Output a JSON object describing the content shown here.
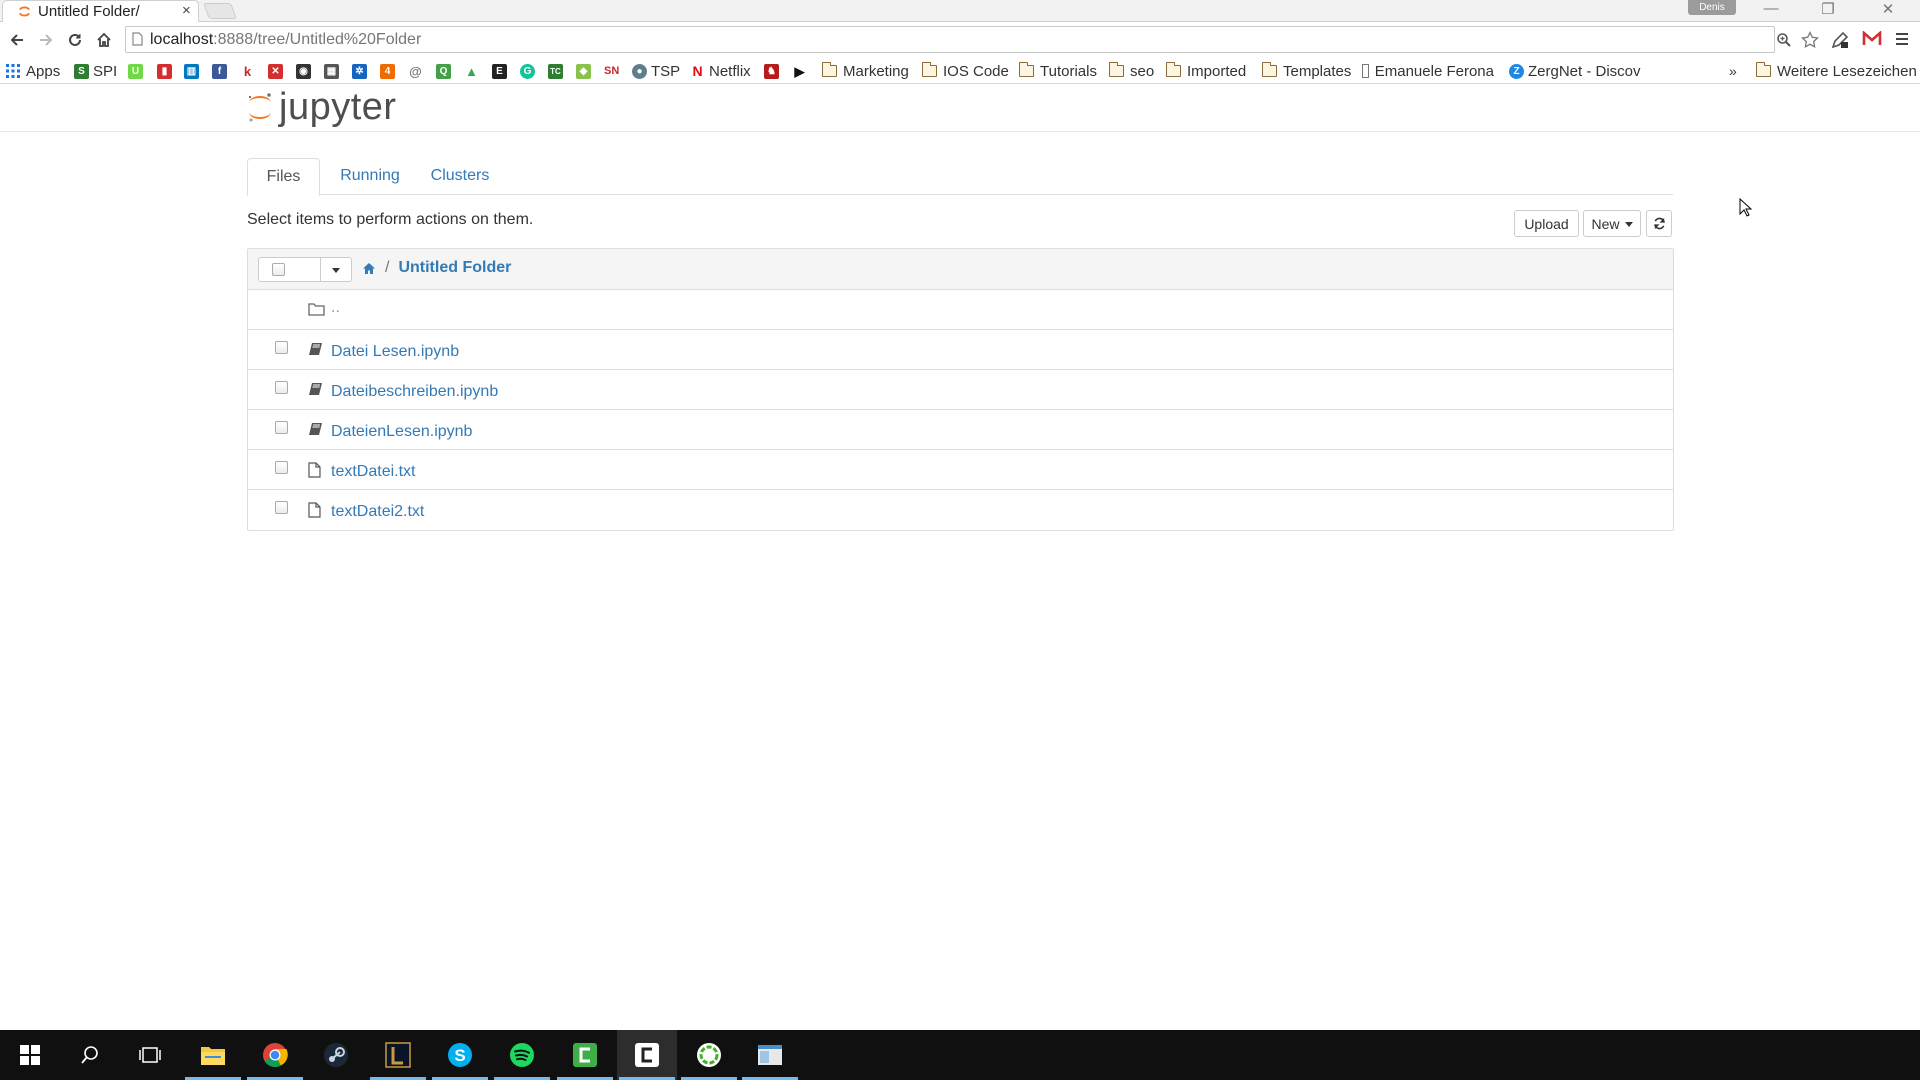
{
  "browser": {
    "tab": {
      "title": "Untitled Folder/",
      "close": "×"
    },
    "profile": "Denis",
    "window_controls": {
      "minimize": "—",
      "restore": "❐",
      "close": "✕"
    },
    "url": {
      "host": "localhost",
      "path": ":8888/tree/Untitled%20Folder"
    },
    "bookmarks": [
      {
        "label": "Apps",
        "icon": "apps-grid-icon"
      },
      {
        "label": "SPI",
        "icon": "spi-icon",
        "color": "#2e7d32"
      },
      {
        "label": "",
        "icon": "upwork-icon",
        "color": "#6fda44"
      },
      {
        "label": "",
        "icon": "red-square-icon",
        "color": "#d32f2f"
      },
      {
        "label": "",
        "icon": "trello-icon",
        "color": "#0079bf"
      },
      {
        "label": "",
        "icon": "facebook-icon",
        "color": "#3b5998"
      },
      {
        "label": "",
        "icon": "k-icon",
        "color": "#c62828"
      },
      {
        "label": "",
        "icon": "cross-icon",
        "color": "#d32f2f"
      },
      {
        "label": "",
        "icon": "camera-icon",
        "color": "#333333"
      },
      {
        "label": "",
        "icon": "pattern-icon",
        "color": "#555555"
      },
      {
        "label": "",
        "icon": "gear-icon",
        "color": "#1565c0"
      },
      {
        "label": "",
        "icon": "four-icon",
        "color": "#ef6c00"
      },
      {
        "label": "",
        "icon": "at-icon",
        "color": "#777777"
      },
      {
        "label": "",
        "icon": "q-icon",
        "color": "#43a047"
      },
      {
        "label": "",
        "icon": "drive-icon",
        "color": "#fbbc05"
      },
      {
        "label": "",
        "icon": "e-icon",
        "color": "#222222"
      },
      {
        "label": "",
        "icon": "grammarly-icon",
        "color": "#15c39a"
      },
      {
        "label": "",
        "icon": "tc-icon",
        "color": "#2e7d32"
      },
      {
        "label": "",
        "icon": "android-icon",
        "color": "#8bc34a"
      },
      {
        "label": "",
        "icon": "sn-icon",
        "color": "#c62828"
      },
      {
        "label": "TSP",
        "icon": "tsp-icon",
        "color": "#607d8b"
      },
      {
        "label": "Netflix",
        "icon": "netflix-icon",
        "color": "#e50914"
      },
      {
        "label": "",
        "icon": "lion-icon",
        "color": "#b71c1c"
      },
      {
        "label": "",
        "icon": "play-icon",
        "color": "#111111"
      },
      {
        "label": "Marketing",
        "icon": "folder-icon"
      },
      {
        "label": "IOS Code",
        "icon": "folder-icon"
      },
      {
        "label": "Tutorials",
        "icon": "folder-icon"
      },
      {
        "label": "seo",
        "icon": "folder-icon"
      },
      {
        "label": "Imported",
        "icon": "folder-icon"
      },
      {
        "label": "Templates",
        "icon": "folder-icon"
      },
      {
        "label": "Emanuele Ferona",
        "icon": "page-icon"
      },
      {
        "label": "ZergNet - Discov",
        "icon": "zergnet-icon",
        "color": "#1e88e5"
      }
    ],
    "bookmarks_overflow": "»",
    "other_bookmarks": "Weitere Lesezeichen"
  },
  "jupyter": {
    "logo": "jupyter",
    "tabs": [
      {
        "label": "Files",
        "active": true
      },
      {
        "label": "Running",
        "active": false
      },
      {
        "label": "Clusters",
        "active": false
      }
    ],
    "hint": "Select items to perform actions on them.",
    "buttons": {
      "upload": "Upload",
      "new": "New"
    },
    "breadcrumb": {
      "separator": "/",
      "current": "Untitled Folder"
    },
    "parent": "..",
    "files": [
      {
        "name": "Datei Lesen.ipynb",
        "type": "notebook"
      },
      {
        "name": "Dateibeschreiben.ipynb",
        "type": "notebook"
      },
      {
        "name": "DateienLesen.ipynb",
        "type": "notebook"
      },
      {
        "name": "textDatei.txt",
        "type": "file"
      },
      {
        "name": "textDatei2.txt",
        "type": "file"
      }
    ]
  },
  "taskbar": {
    "items": [
      {
        "icon": "windows-start-icon"
      },
      {
        "icon": "search-icon"
      },
      {
        "icon": "task-view-icon"
      },
      {
        "icon": "file-explorer-icon",
        "open": true
      },
      {
        "icon": "chrome-icon",
        "open": true
      },
      {
        "icon": "steam-icon"
      },
      {
        "icon": "lol-icon",
        "open": true
      },
      {
        "icon": "skype-icon",
        "open": true
      },
      {
        "icon": "spotify-icon",
        "open": true
      },
      {
        "icon": "camtasia-recorder-icon",
        "open": true
      },
      {
        "icon": "camtasia-icon",
        "open": true,
        "active": true
      },
      {
        "icon": "anaconda-icon",
        "open": true
      },
      {
        "icon": "window-app-icon",
        "open": true
      }
    ]
  }
}
